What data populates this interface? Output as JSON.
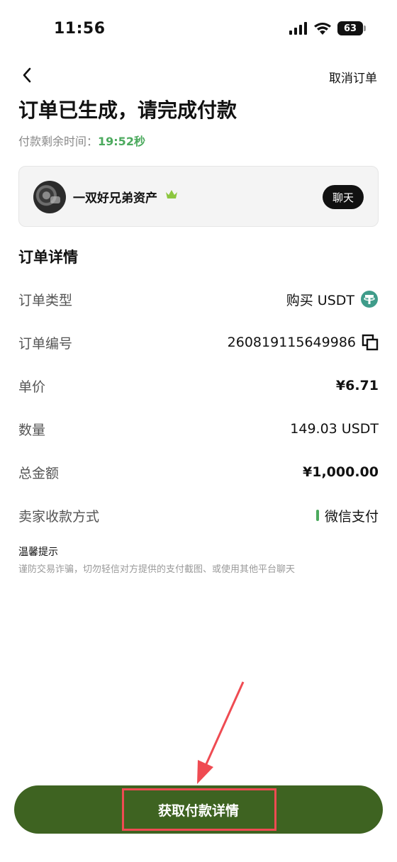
{
  "status_bar": {
    "time": "11:56",
    "battery": "63"
  },
  "nav": {
    "cancel_label": "取消订单"
  },
  "header": {
    "title": "订单已生成，请完成付款",
    "timer_label": "付款剩余时间：",
    "timer_value": "19:52秒"
  },
  "seller": {
    "name": "一双好兄弟资产",
    "chat_label": "聊天"
  },
  "order": {
    "section_title": "订单详情",
    "rows": [
      {
        "label": "订单类型",
        "value": "购买 USDT"
      },
      {
        "label": "订单编号",
        "value": "260819115649986"
      },
      {
        "label": "单价",
        "value": "¥6.71"
      },
      {
        "label": "数量",
        "value": "149.03 USDT"
      },
      {
        "label": "总金额",
        "value": "¥1,000.00"
      },
      {
        "label": "卖家收款方式",
        "value": "微信支付"
      }
    ]
  },
  "tips": {
    "title": "温馨提示",
    "body": "谨防交易诈骗，切勿轻信对方提供的支付截图、或使用其他平台聊天"
  },
  "footer": {
    "primary_label": "获取付款详情"
  },
  "colors": {
    "accent_green": "#4caa5e",
    "button_green": "#3e6321",
    "highlight_red": "#ef4b52",
    "tether_green": "#3f9c8a",
    "crown_green": "#8cc63f"
  },
  "icons": {
    "back": "chevron-left-icon",
    "crown": "crown-icon",
    "tether": "tether-icon",
    "copy": "copy-icon"
  }
}
